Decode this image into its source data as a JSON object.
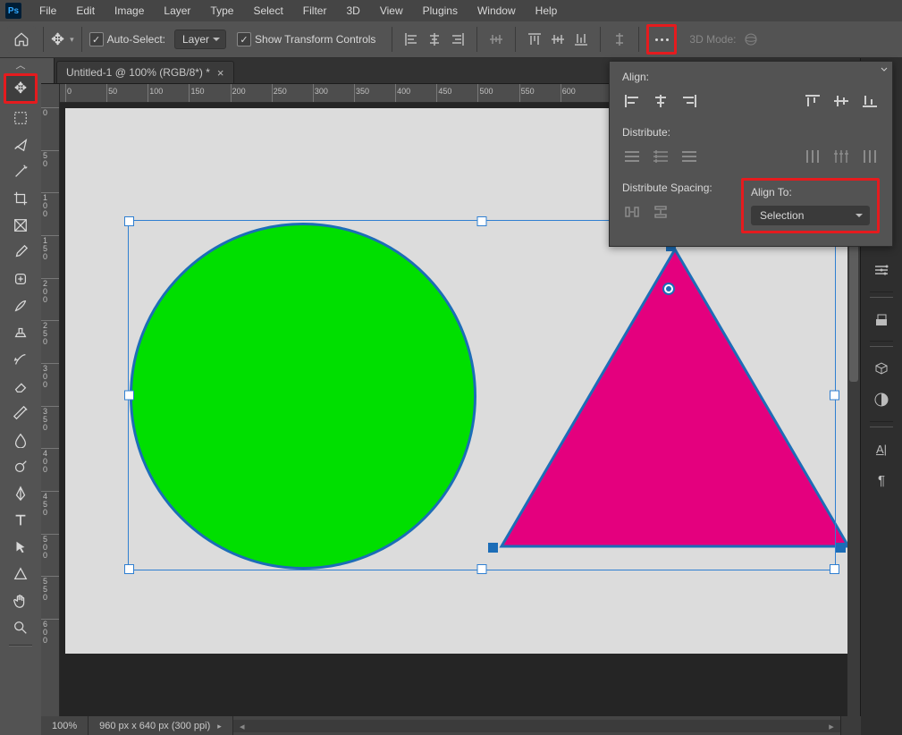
{
  "menu": [
    "File",
    "Edit",
    "Image",
    "Layer",
    "Type",
    "Select",
    "Filter",
    "3D",
    "View",
    "Plugins",
    "Window",
    "Help"
  ],
  "options": {
    "auto_select_label": "Auto-Select:",
    "auto_select_value": "Layer",
    "show_transform_label": "Show Transform Controls",
    "three_d_label": "3D Mode:"
  },
  "tab": {
    "title": "Untitled-1 @ 100% (RGB/8*) *"
  },
  "hruler_ticks": [
    0,
    50,
    100,
    150,
    200,
    250,
    300,
    350,
    400,
    450,
    500,
    550,
    600
  ],
  "vruler_ticks": [
    0,
    50,
    100,
    150,
    200,
    250,
    300,
    350,
    400,
    450,
    500,
    550,
    600
  ],
  "flyout": {
    "align": "Align:",
    "distribute": "Distribute:",
    "distribute_spacing": "Distribute Spacing:",
    "align_to": "Align To:",
    "align_to_value": "Selection"
  },
  "status": {
    "zoom": "100%",
    "dims": "960 px x 640 px (300 ppi)"
  },
  "colors": {
    "highlight": "#e51b1e",
    "circle": "#00df00",
    "triangle": "#e4007e",
    "stroke": "#1c6db7"
  }
}
